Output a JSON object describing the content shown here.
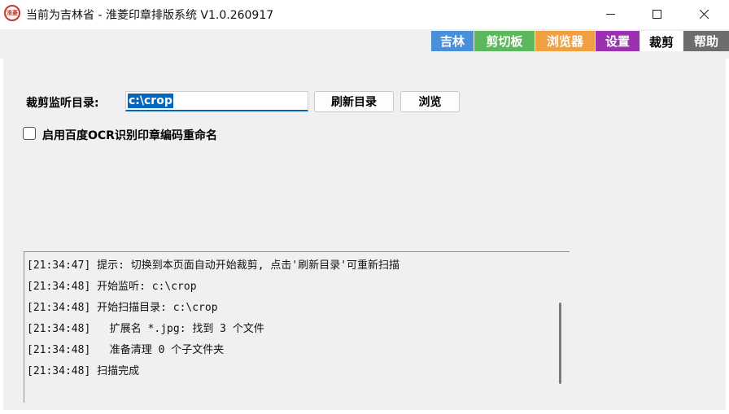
{
  "window": {
    "title": "当前为吉林省 - 淮菱印章排版系统 V1.0.260917",
    "icon_text": "淮菱"
  },
  "tabs": [
    {
      "label": "吉林",
      "color": "#4a90d9"
    },
    {
      "label": "剪切板",
      "color": "#5cb85c"
    },
    {
      "label": "浏览器",
      "color": "#f0a040"
    },
    {
      "label": "设置",
      "color": "#9b30b0"
    },
    {
      "label": "裁剪",
      "color": "#ffffff",
      "active": true
    },
    {
      "label": "帮助",
      "color": "#6d6d6d"
    }
  ],
  "crop": {
    "dir_label": "裁剪监听目录:",
    "dir_value": "c:\\crop",
    "refresh_label": "刷新目录",
    "browse_label": "浏览",
    "ocr_label": "启用百度OCR识别印章编码重命名",
    "ocr_checked": false
  },
  "log": [
    "[21:34:47] 提示: 切换到本页面自动开始裁剪, 点击'刷新目录'可重新扫描",
    "[21:34:48] 开始监听: c:\\crop",
    "[21:34:48] 开始扫描目录: c:\\crop",
    "[21:34:48]   扩展名 *.jpg: 找到 3 个文件",
    "[21:34:48]   准备清理 0 个子文件夹",
    "[21:34:48] 扫描完成"
  ]
}
